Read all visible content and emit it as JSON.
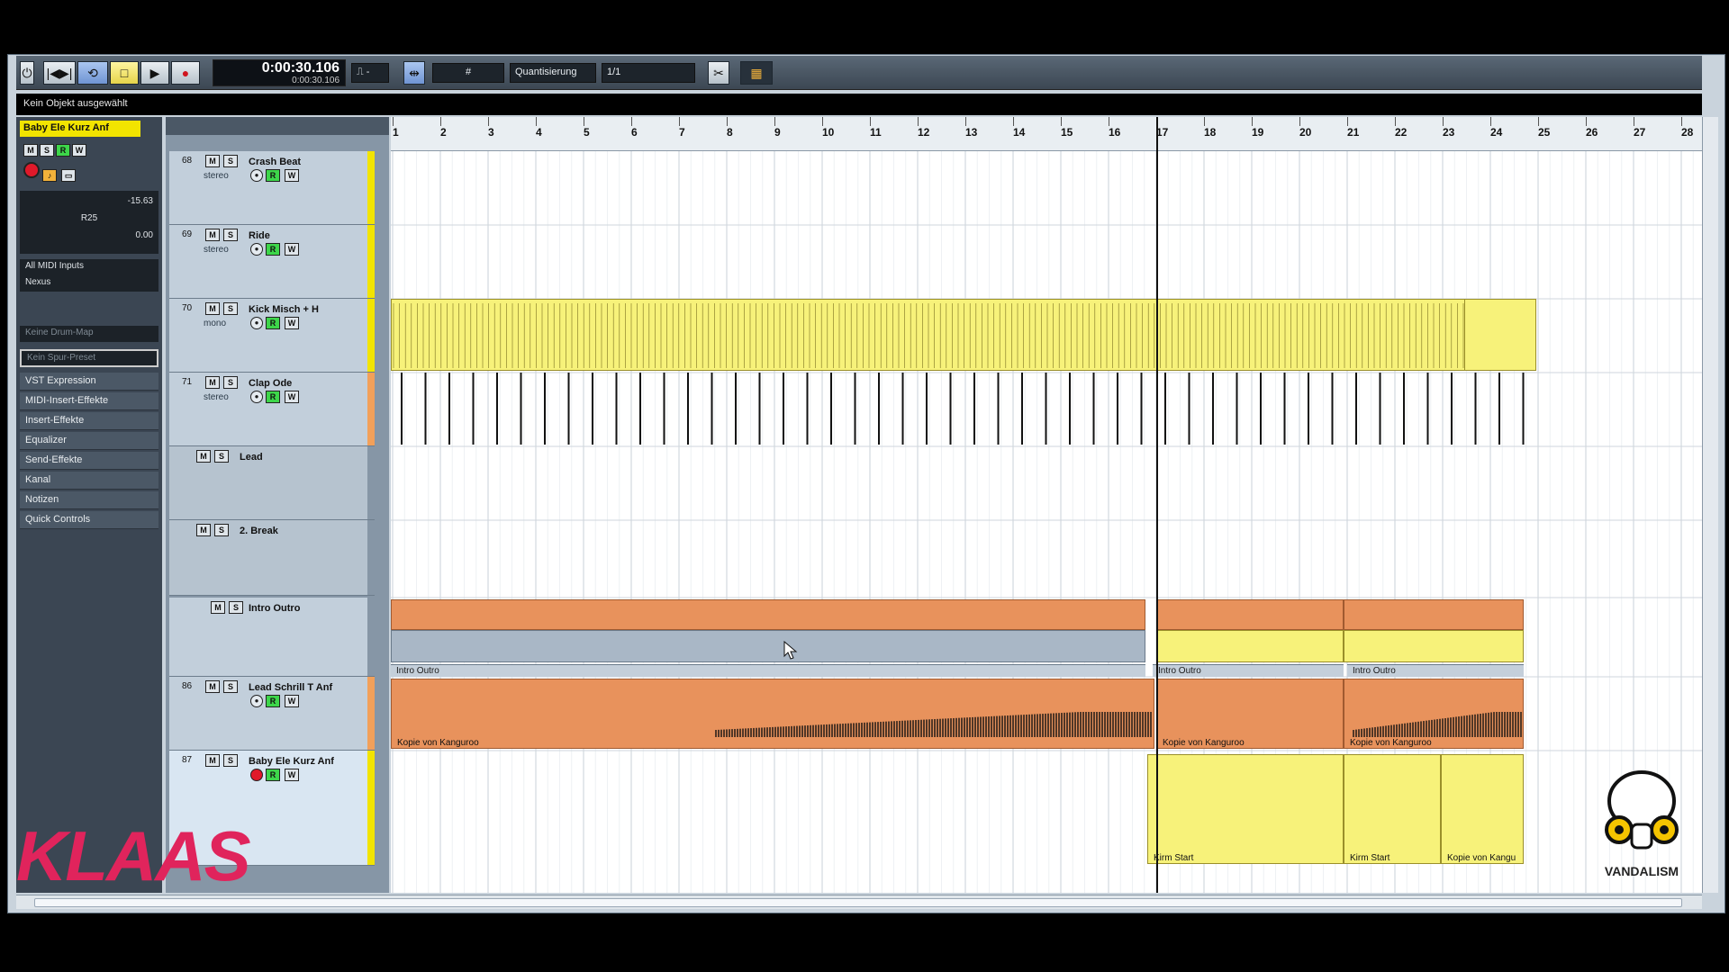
{
  "transport": {
    "time_main": "0:00:30.106",
    "time_sub": "0:00:30.106",
    "quantize_label": "Quantisierung",
    "quantize_value": "1/1",
    "dash_value": "-"
  },
  "info_line": "Kein Objekt ausgewählt",
  "inspector": {
    "track_title": "Baby Ele Kurz Anf",
    "volume": "-15.63",
    "pan": "R25",
    "delay": "0.00",
    "midi_input": "All MIDI Inputs",
    "output": "Nexus",
    "drum_map": "Keine Drum-Map",
    "track_preset": "Kein Spur-Preset",
    "sections": [
      "VST Expression",
      "MIDI-Insert-Effekte",
      "Insert-Effekte",
      "Equalizer",
      "Send-Effekte",
      "Kanal",
      "Notizen",
      "Quick Controls"
    ]
  },
  "tracks": [
    {
      "num": "68",
      "name": "Crash Beat",
      "sub": "stereo"
    },
    {
      "num": "69",
      "name": "Ride",
      "sub": "stereo"
    },
    {
      "num": "70",
      "name": "Kick Misch + H",
      "sub": "mono"
    },
    {
      "num": "71",
      "name": "Clap Ode",
      "sub": "stereo"
    },
    {
      "num": "",
      "name": "Lead",
      "sub": ""
    },
    {
      "num": "",
      "name": "2. Break",
      "sub": ""
    },
    {
      "num": "",
      "name": "Intro Outro",
      "sub": ""
    },
    {
      "num": "86",
      "name": "Lead Schrill T Anf",
      "sub": ""
    },
    {
      "num": "87",
      "name": "Baby Ele Kurz Anf",
      "sub": ""
    }
  ],
  "ruler": [
    "1",
    "2",
    "3",
    "4",
    "5",
    "6",
    "7",
    "8",
    "9",
    "10",
    "11",
    "12",
    "13",
    "14",
    "15",
    "16",
    "17",
    "18",
    "19",
    "20",
    "21",
    "22",
    "23",
    "24",
    "25",
    "26",
    "27",
    "28"
  ],
  "parts": {
    "folder_1": "Intro Outro",
    "folder_2": "Intro Outro",
    "folder_3": "Intro Outro",
    "lead_1": "Kopie von Kanguroo",
    "lead_2": "Kopie von Kanguroo",
    "lead_3": "Kopie von Kanguroo",
    "baby_1": "Kirm Start",
    "baby_2": "Kirm Start",
    "baby_3": "Kopie von Kangu"
  },
  "logos": {
    "left": "KLAAS",
    "right": "VANDALISM"
  },
  "colors": {
    "accent_yellow": "#f7f27a",
    "accent_orange": "#e8925c",
    "brand_pink": "#e0245c"
  }
}
